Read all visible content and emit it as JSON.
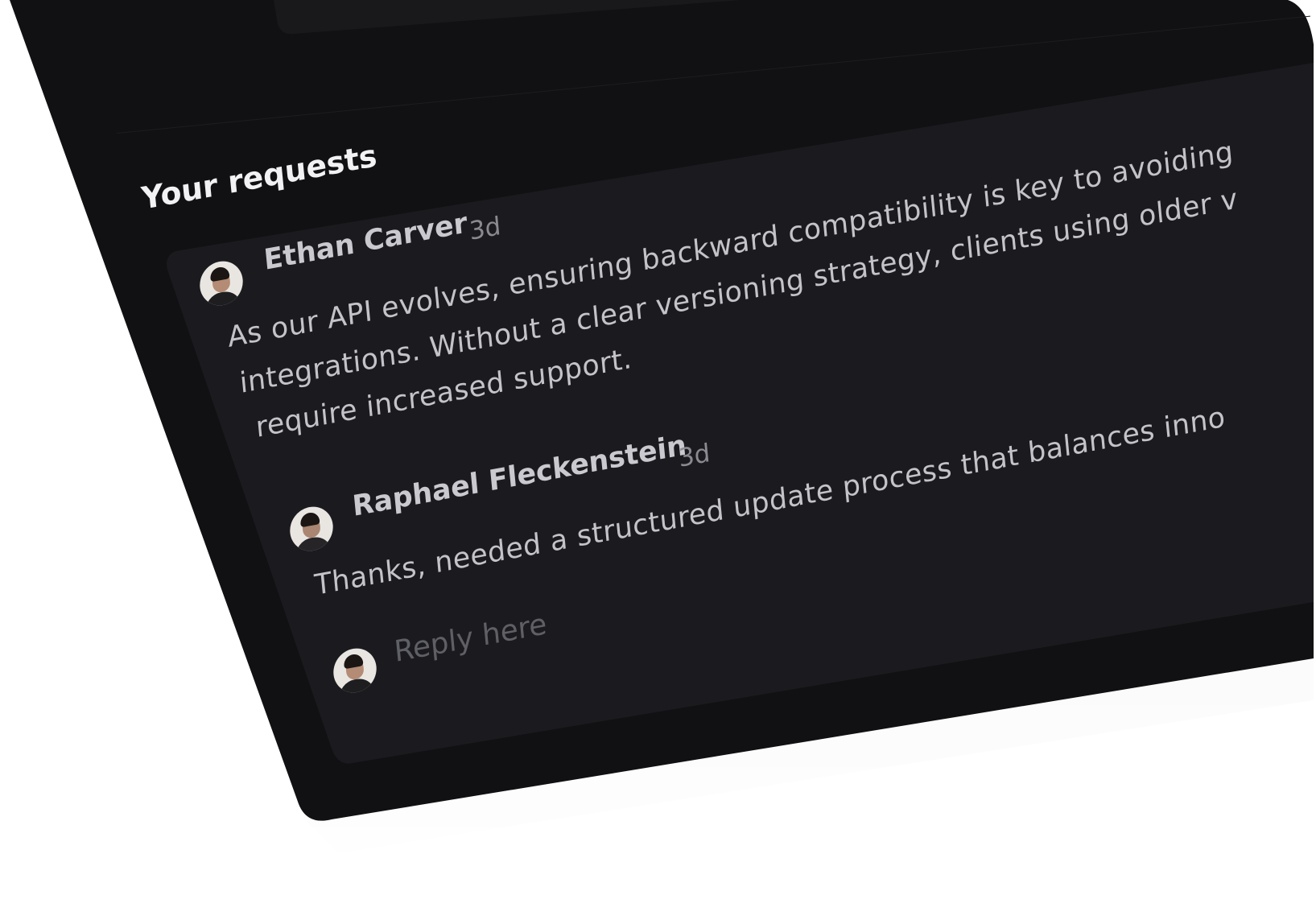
{
  "section": {
    "title": "Your requests"
  },
  "request": {
    "author": "Ethan Carver",
    "time": "3d",
    "body_lines": [
      "As our API evolves, ensuring backward compatibility is key to avoiding",
      "integrations. Without a clear versioning strategy, clients using older v",
      "require increased support."
    ],
    "avatar_icon": "user-avatar"
  },
  "reply": {
    "author": "Raphael Fleckenstein",
    "time": "3d",
    "body": "Thanks, needed a structured update process that balances inno",
    "avatar_icon": "user-avatar"
  },
  "composer": {
    "placeholder": "Reply here",
    "avatar_icon": "user-avatar"
  },
  "colors": {
    "background": "#111113",
    "card": "#1b1b1f",
    "title_text": "#f2f2f4",
    "author_text": "#c9c9cf",
    "muted_text": "#8a8a91",
    "placeholder_text": "#5f5f66"
  }
}
